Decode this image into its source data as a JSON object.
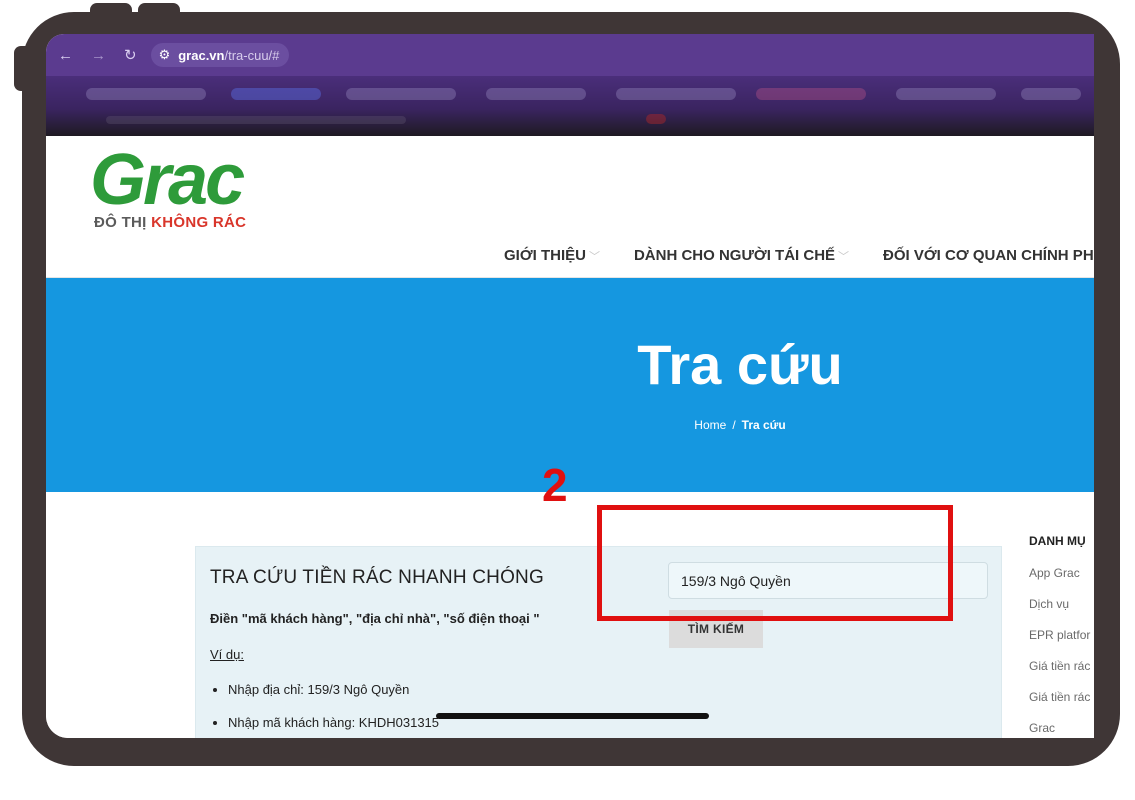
{
  "browser": {
    "url_domain": "grac.vn",
    "url_path": "/tra-cuu/#"
  },
  "logo": {
    "wordmark": "Grac",
    "tagline_part1": "ĐÔ THỊ ",
    "tagline_part2": "KHÔNG RÁC"
  },
  "nav": {
    "items": [
      {
        "label": "GIỚI THIỆU"
      },
      {
        "label": "DÀNH CHO NGƯỜI TÁI CHẾ"
      },
      {
        "label": "ĐỐI VỚI CƠ QUAN CHÍNH PH"
      }
    ]
  },
  "hero": {
    "title": "Tra cứu",
    "breadcrumb_home": "Home",
    "breadcrumb_sep": "/",
    "breadcrumb_current": "Tra cứu"
  },
  "panel": {
    "heading": "TRA CỨU TIỀN RÁC NHANH CHÓNG",
    "hint": "Điền \"mã khách hàng\", \"địa chỉ nhà\", \"số điện thoại \"",
    "example_label": "Ví dụ:",
    "examples": [
      "Nhập địa chỉ: 159/3 Ngô Quyền",
      "Nhập mã khách hàng: KHDH031315"
    ]
  },
  "search": {
    "value": "159/3 Ngô Quyền",
    "button_label": "TÌM KIẾM"
  },
  "annotation": {
    "step": "2",
    "color": "#e01010"
  },
  "sidebar": {
    "title": "DANH MỤ",
    "items": [
      "App Grac",
      "Dịch vụ",
      "EPR platfor",
      "Giá tiền rác",
      "Giá tiền rác",
      "Grac"
    ]
  },
  "colors": {
    "hero_bg": "#1597e0",
    "brand_green": "#2e9b3a",
    "brand_red": "#d9362b",
    "browser_bar": "#5b3b8f"
  }
}
